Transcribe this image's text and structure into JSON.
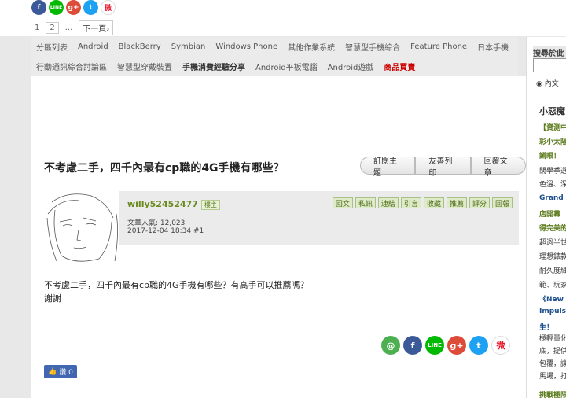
{
  "share_top": {
    "fb": "f",
    "line": "LINE",
    "gp": "g+",
    "tw": "t",
    "wb": "微"
  },
  "pager": {
    "p1": "1",
    "p2": "2",
    "ellipsis": "...",
    "next": "下一頁›"
  },
  "nav": {
    "row1": [
      "分區列表",
      "Android",
      "BlackBerry",
      "Symbian",
      "Windows Phone",
      "其他作業系統",
      "智慧型手機綜合",
      "Feature Phone",
      "日本手機"
    ],
    "row2": [
      "行動通訊綜合討論區",
      "智慧型穿戴裝置",
      "手機消費經驗分享",
      "Android平板電腦",
      "Android遊戲",
      "商品買賣"
    ]
  },
  "thread": {
    "title": "不考慮二手，四千內最有cp職的4G手機有哪些？",
    "actions": [
      "訂閱主題",
      "友善列印",
      "回覆文章"
    ]
  },
  "post": {
    "author": "willy52452477",
    "badge": "樓主",
    "popularity": "文章人氣: 12,023",
    "datetime": "2017-12-04 18:34",
    "floor": "#1",
    "buttons": [
      "回文",
      "私訊",
      "連結",
      "引言",
      "收藏",
      "推薦",
      "評分",
      "回報"
    ],
    "body_line1": "不考慮二手，四千內最有cp職的4G手機有哪些？有高手可以推薦嗎？",
    "body_line2": "謝謝"
  },
  "share_bottom": {
    "push": "@",
    "fb": "f",
    "line": "LINE",
    "gp": "g+",
    "tw": "t",
    "wb": "微"
  },
  "like": {
    "label": "讚 0"
  },
  "sidebar": {
    "search_label": "搜尋於此",
    "radio_label": "內文",
    "heading": "小惡魔",
    "lines": [
      {
        "text": "【資測中",
        "style": "g"
      },
      {
        "text": "彩小太陽",
        "style": "g"
      },
      {
        "text": "謊眼！",
        "style": "g"
      },
      {
        "text": "闊學季選",
        "style": ""
      },
      {
        "text": "色溫、深",
        "style": ""
      },
      {
        "text": "Grand S",
        "style": "b"
      },
      {
        "text": "店開幕",
        "style": "g"
      },
      {
        "text": "得完美的",
        "style": "g"
      },
      {
        "text": "超過半世",
        "style": ""
      },
      {
        "text": "理想錶款",
        "style": ""
      },
      {
        "text": "耐久度維",
        "style": ""
      },
      {
        "text": "範、玩家",
        "style": ""
      },
      {
        "text": "《New",
        "style": "b"
      },
      {
        "text": "Impulse",
        "style": "b"
      },
      {
        "text": "生！",
        "style": "b"
      },
      {
        "text": "極輕量化",
        "style": ""
      },
      {
        "text": "底，提供",
        "style": ""
      },
      {
        "text": "包覆，讓",
        "style": ""
      },
      {
        "text": "馬場，打",
        "style": ""
      },
      {
        "text": "挑戰極限",
        "style": "g"
      }
    ]
  }
}
